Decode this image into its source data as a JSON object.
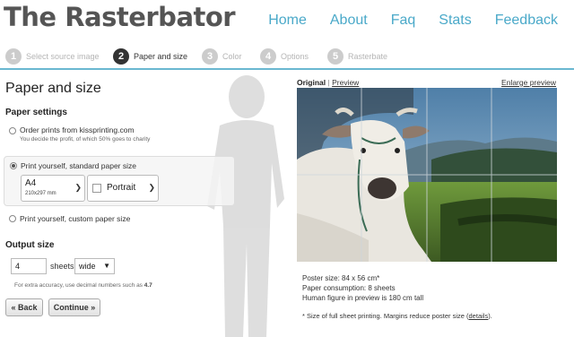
{
  "header": {
    "logo": "The Rasterbator",
    "nav": [
      "Home",
      "About",
      "Faq",
      "Stats",
      "Feedback"
    ]
  },
  "steps": [
    {
      "num": "1",
      "label": "Select source image",
      "active": false
    },
    {
      "num": "2",
      "label": "Paper and size",
      "active": true
    },
    {
      "num": "3",
      "label": "Color",
      "active": false
    },
    {
      "num": "4",
      "label": "Options",
      "active": false
    },
    {
      "num": "5",
      "label": "Rasterbate",
      "active": false
    }
  ],
  "left": {
    "title": "Paper and size",
    "paper_settings": "Paper settings",
    "opt1_label": "Order prints from kissprinting.com",
    "opt1_note": "You decide the profit, of which 50% goes to charity",
    "opt2_label": "Print yourself, standard paper size",
    "paper_size": "A4",
    "paper_dims": "210x297 mm",
    "orientation": "Portrait",
    "opt3_label": "Print yourself, custom paper size",
    "output_size": "Output size",
    "sheets_value": "4",
    "sheets_label": "sheets",
    "dimension": "wide",
    "accuracy_note": "For extra accuracy, use decimal numbers such as",
    "accuracy_example": "4.7",
    "back_button": "« Back",
    "continue_button": "Continue »"
  },
  "preview": {
    "tab_original": "Original",
    "tab_separator": "|",
    "tab_preview": "Preview",
    "enlarge": "Enlarge preview",
    "poster_size": "Poster size: 84 x 56 cm*",
    "paper_consumption": "Paper consumption: 8 sheets",
    "human_figure": "Human figure in preview is 180 cm tall",
    "footnote": "* Size of full sheet printing. Margins reduce poster size (",
    "footnote_link": "details",
    "footnote_end": ")."
  },
  "colors": {
    "accent": "#4aa9c9",
    "step_active": "#333333",
    "step_inactive": "#cccccc"
  }
}
